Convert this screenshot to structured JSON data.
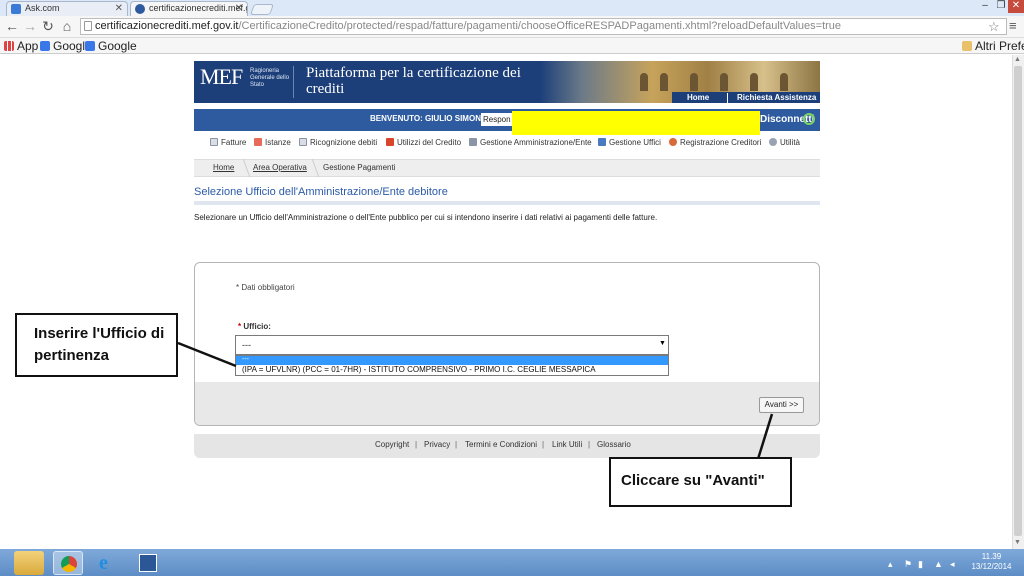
{
  "browser": {
    "tabs": [
      {
        "title": "Ask.com"
      },
      {
        "title": "certificazionecrediti.mef.g"
      }
    ],
    "url_host": "certificazionecrediti.mef.gov.it",
    "url_path": "/CertificazioneCredito/protected/respad/fatture/pagamenti/chooseOfficeRESPADPagamenti.xhtml?reloadDefaultValues=true",
    "bookmarks": [
      "App",
      "Google",
      "Google"
    ],
    "other_bookmarks": "Altri Preferiti"
  },
  "site": {
    "logo": "MEF",
    "logo_sub": "Ragioneria Generale dello Stato",
    "title": "Piattaforma per la certificazione dei crediti",
    "header_links": [
      "Home",
      "Richiesta Assistenza"
    ],
    "welcome": "BENVENUTO: GIULIO SIMONI",
    "role_value": "Respon",
    "logout": "Disconnetti",
    "menu": [
      {
        "label": "Fatture",
        "icon": "document-icon"
      },
      {
        "label": "Istanze",
        "icon": "document-red-icon"
      },
      {
        "label": "Ricognizione debiti",
        "icon": "document-icon"
      },
      {
        "label": "Utilizzi del Credito",
        "icon": "stamp-icon"
      },
      {
        "label": "Gestione Amministrazione/Ente",
        "icon": "building-icon"
      },
      {
        "label": "Gestione Uffici",
        "icon": "network-icon"
      },
      {
        "label": "Registrazione Creditori",
        "icon": "person-icon"
      },
      {
        "label": "Utilità",
        "icon": "gear-icon"
      }
    ],
    "breadcrumb": [
      "Home",
      "Area Operativa",
      "Gestione Pagamenti"
    ],
    "section_title": "Selezione Ufficio dell'Amministrazione/Ente debitore",
    "section_desc": "Selezionare un Ufficio dell'Amministrazione o dell'Ente pubblico per cui si intendono inserire i dati relativi ai pagamenti delle fatture.",
    "form": {
      "required_note": "* Dati obbligatori",
      "field_label": "Ufficio:",
      "field_star": "*",
      "selected_value": "---",
      "options": [
        "---",
        "(IPA = UFVLNR) (PCC = 01-7HR) - ISTITUTO COMPRENSIVO - PRIMO I.C. CEGLIE MESSAPICA"
      ],
      "next_button": "Avanti >>"
    },
    "footer_links": [
      "Copyright",
      "Privacy",
      "Termini e Condizioni",
      "Link Utili",
      "Glossario"
    ]
  },
  "annotations": {
    "callout_office": "Inserire l'Ufficio di pertinenza",
    "callout_next": "Cliccare su \"Avanti\""
  },
  "taskbar": {
    "time": "11.39",
    "date": "13/12/2014"
  },
  "colors": {
    "header_blue": "#1c3f7a",
    "userbar_blue": "#2e5ba0",
    "title_blue": "#2b5ba8",
    "highlight_yellow": "#ffff00",
    "selected_option": "#3399ff"
  }
}
